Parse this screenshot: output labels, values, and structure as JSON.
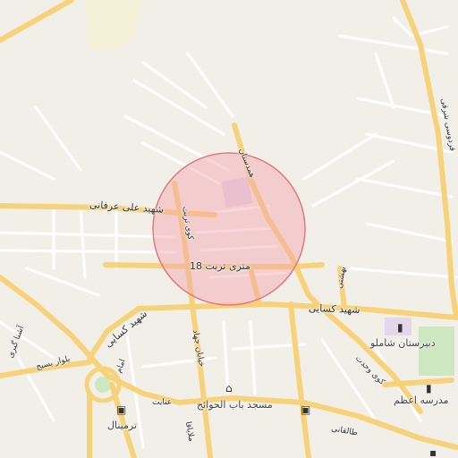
{
  "map": {
    "accent_circle_fill": "#f5b7bd",
    "accent_circle_stroke": "#e07a85",
    "major_road_color": "#f7d27a",
    "minor_road_color": "#ffffff",
    "background_color": "#f2efe9",
    "park_color": "#cde8c1",
    "poi_color": "#e3d8ea",
    "roads": {
      "ali_erfani": "شهید علی عرفانی",
      "torbat_18m": "18 متری تربت",
      "kasaei": "شهید کسایی",
      "hamadan_st": "همدستان",
      "kooy_torbat": "کوی تربت",
      "saeedi_bahar": "بهشتی",
      "ferdowsi_north": "فردوسی شرقی",
      "hafez_kasaei_2": "شهید کسایی",
      "vahdat": "کوی وحدت",
      "jahad": "خیابان جهاد",
      "mollayaha": "ملایاقا",
      "boulevard_basij": "بلوار بسیج",
      "imam": "امام",
      "enayat": "عنایت",
      "taleghani": "طالقانی",
      "ashna": "آشنا گیری"
    },
    "pois": {
      "shamlou_school": "دبیرستان شاملو",
      "azam_school": "مدرسه اعظم",
      "bab_alhavaej_mosque": "مسجد باب الحوائج",
      "terminal": "ترمینال"
    },
    "icons": {
      "school_icon_1": "school-icon",
      "school_icon_2": "school-icon",
      "mosque_icon": "mosque-icon",
      "bus_icon_1": "bus-icon",
      "bus_icon_2": "bus-icon",
      "other_icon": "building-icon"
    }
  }
}
